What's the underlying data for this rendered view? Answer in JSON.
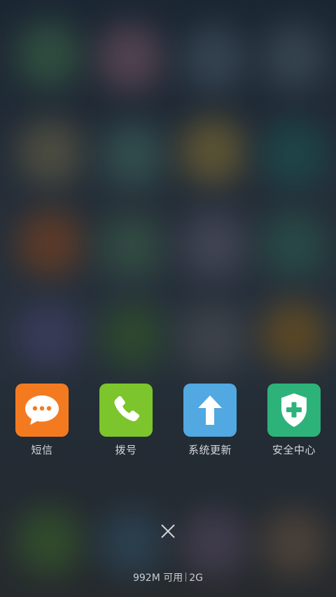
{
  "recent_apps": [
    {
      "label": "短信",
      "icon": "message-bubble-icon",
      "color": "#f47a20"
    },
    {
      "label": "拨号",
      "icon": "phone-icon",
      "color": "#7cc52c"
    },
    {
      "label": "系统更新",
      "icon": "arrow-up-icon",
      "color": "#52a8e0"
    },
    {
      "label": "安全中心",
      "icon": "shield-plus-icon",
      "color": "#2db37a"
    }
  ],
  "close_icon": "close-icon",
  "memory": {
    "available": "992M 可用",
    "total": "2G"
  }
}
